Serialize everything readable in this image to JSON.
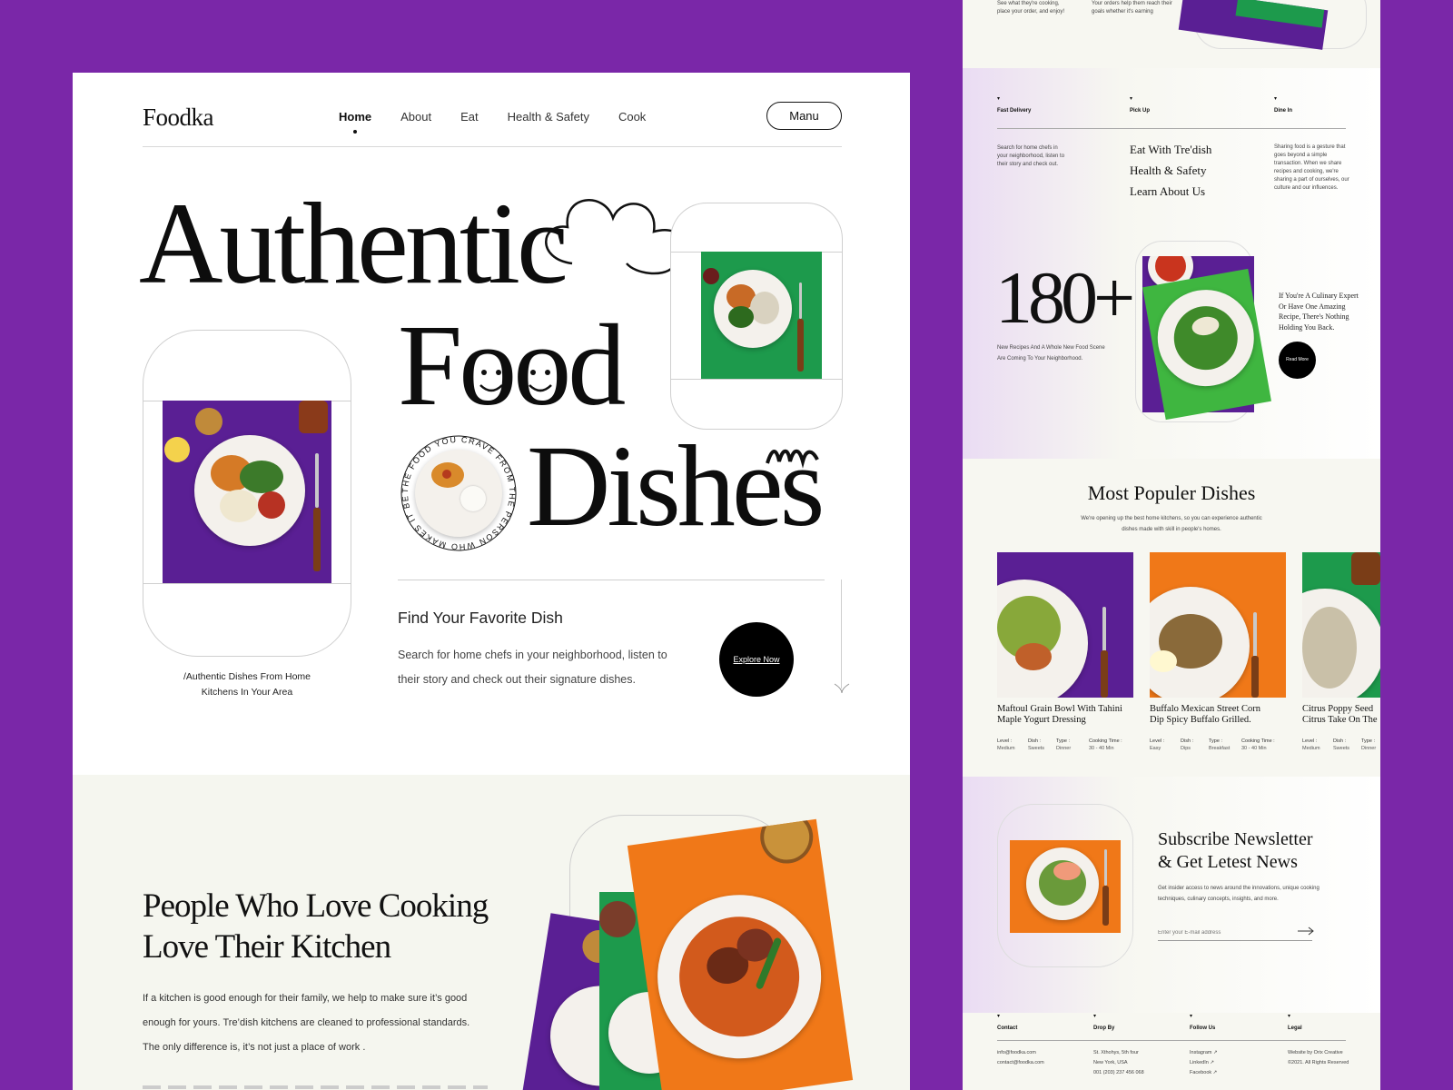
{
  "brand": {
    "logo": "Foodka"
  },
  "nav": {
    "items": [
      "Home",
      "About",
      "Eat",
      "Health & Safety",
      "Cook"
    ],
    "menu_button": "Manu"
  },
  "hero": {
    "line1": "Authentic",
    "line2": "Food",
    "line3": "Dishes",
    "badge_text": "THE FOOD YOU CRAVE FROM THE PERSON WHO MAKES IT BEST • GET ",
    "left_caption_line1": "/Authentic Dishes From Home",
    "left_caption_line2": "Kitchens In Your Area",
    "find_title": "Find Your Favorite Dish",
    "find_desc_line1": "Search for home chefs in your neighborhood, listen to",
    "find_desc_line2": "their story and check out their signature dishes.",
    "explore_button": "Explore Now"
  },
  "kitchen": {
    "title_line1": "People Who Love Cooking",
    "title_line2": "Love Their Kitchen",
    "desc_line1": "If a kitchen is good enough for their family, we help to make sure it’s good",
    "desc_line2": "enough for yours. Tre’dish kitchens are cleaned to professional standards.",
    "desc_line3": "The only difference is, it’s not just a place of work ."
  },
  "side": {
    "top_left_text_1": "See what they're cooking,",
    "top_left_text_2": "place your order, and enjoy!",
    "top_mid_text_1": "Your orders help them reach their",
    "top_mid_text_2": "goals whether it's earning",
    "tabs": [
      "Fast Delivery",
      "Pick Up",
      "Dine In"
    ],
    "search_text_1": "Search for home chefs in",
    "search_text_2": "your neighborhood, listen to",
    "search_text_3": "their story and check out.",
    "links": [
      "Eat With Tre'dish",
      "Health & Safety",
      "Learn About Us"
    ],
    "sharing_text_1": "Sharing food is a gesture that",
    "sharing_text_2": "goes beyond a simple",
    "sharing_text_3": "transaction. When we share",
    "sharing_text_4": "recipes and cooking, we're",
    "sharing_text_5": "sharing a part of ourselves, our",
    "sharing_text_6": "culture and our influences.",
    "stat_number": "180+",
    "stat_desc_1": "New Recipes And A Whole New Food Scene",
    "stat_desc_2": "Are Coming To Your Neighborhood.",
    "expert_1": "If You're A Culinary Expert",
    "expert_2": "Or Have One Amazing",
    "expert_3": "Recipe, There's Nothing",
    "expert_4": "Holding You Back.",
    "read_more": "Read More",
    "popular_title": "Most Populer Dishes",
    "popular_desc_1": "We're opening up the best home kitchens, so you can experience authentic",
    "popular_desc_2": "dishes made with skill in people's homes.",
    "dishes": [
      {
        "name1": "Maftoul Grain Bowl With Tahini",
        "name2": "Maple Yogurt Dressing",
        "level": "Medium",
        "dish": "Sweets",
        "type": "Dinner",
        "time": "30 - 40 Min"
      },
      {
        "name1": "Buffalo Mexican Street Corn",
        "name2": "Dip Spicy Buffalo Grilled.",
        "level": "Easy",
        "dish": "Dips",
        "type": "Breakfast",
        "time": "30 - 40 Min"
      },
      {
        "name1": "Citrus Poppy Seed",
        "name2": "Citrus Take On The",
        "level": "Medium",
        "dish": "Sweets",
        "type": "Dinner",
        "time": ""
      }
    ],
    "meta_labels": {
      "level": "Level :",
      "dish": "Dish :",
      "type": "Type :",
      "time": "Cooking Time :"
    },
    "newsletter_title_1": "Subscribe Newsletter",
    "newsletter_title_2": "& Get Letest News",
    "newsletter_desc_1": "Get insider access to news around the innovations, unique cooking",
    "newsletter_desc_2": "techniques, culinary concepts, insights, and more.",
    "email_placeholder": "Enter your E-mail address",
    "footer_heads": [
      "Contact",
      "Drop By",
      "Follow Us",
      "Legal"
    ],
    "footer_contact": [
      "info@foodka.com",
      "contact@foodka.com"
    ],
    "footer_drop": [
      "St. Xthohys, 5th four",
      "New York, USA",
      "001 (203) 237 456 068"
    ],
    "footer_follow": [
      "Instagram ↗",
      "LinkedIn ↗",
      "Facebook ↗"
    ],
    "footer_legal": [
      "Website by Orix Creative",
      "©2021. All Rights Reserved"
    ]
  },
  "colors": {
    "purple": "#7a27a8",
    "green": "#1d9a4c",
    "orange": "#f07818",
    "cream": "#f5f6ef"
  }
}
